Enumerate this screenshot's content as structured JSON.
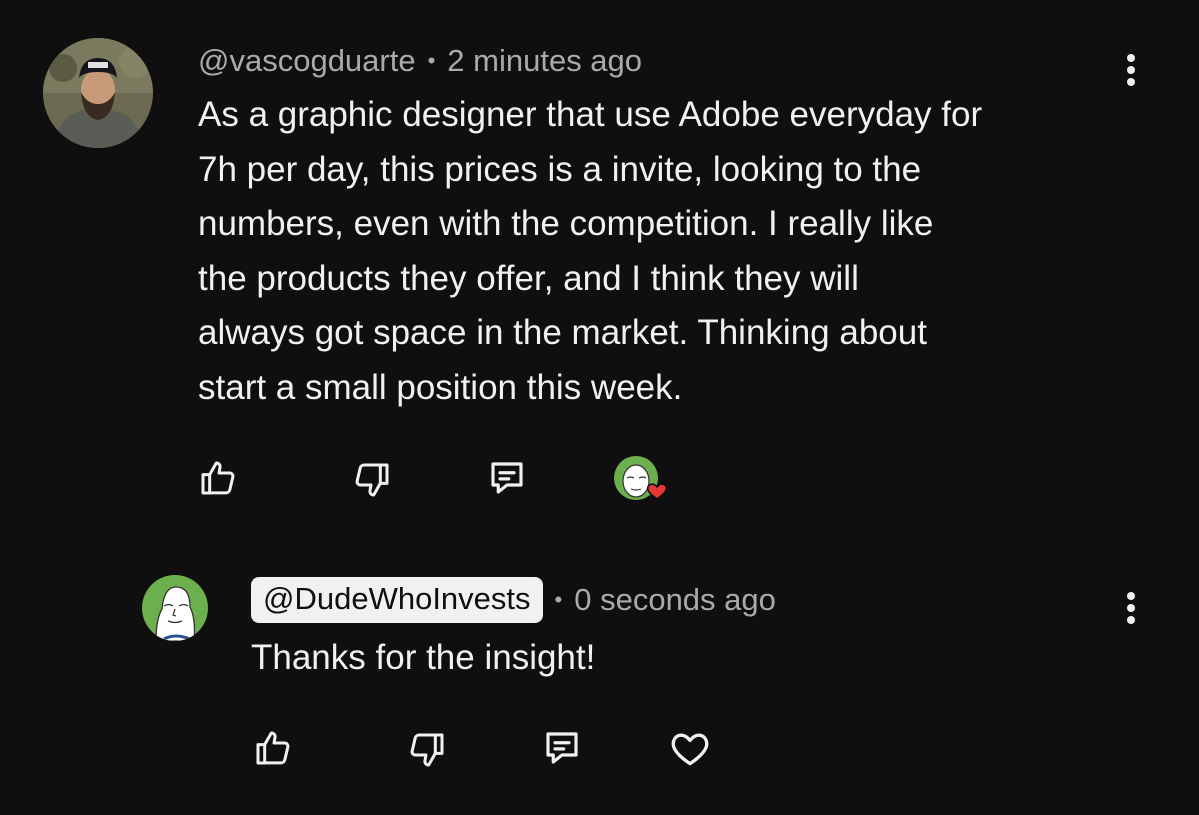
{
  "comment": {
    "author": "@vascogduarte",
    "separator": "•",
    "time": "2 minutes ago",
    "text_lines": [
      "As a graphic designer that use Adobe everyday for",
      "7h per day, this prices is a invite, looking to the",
      "numbers, even with the competition. I really like",
      "the products they offer, and I think they will",
      "always got space in the market. Thinking about",
      "start a small position this week."
    ],
    "icons": {
      "avatar": "user-avatar-photo",
      "menu": "more-vertical-icon",
      "like": "thumbs-up-icon",
      "dislike": "thumbs-down-icon",
      "reply": "reply-comment-icon",
      "hearted": "creator-heart-badge"
    }
  },
  "reply": {
    "author": "@DudeWhoInvests",
    "separator": "•",
    "time": "0 seconds ago",
    "text": "Thanks for the insight!",
    "icons": {
      "avatar": "wojak-avatar",
      "menu": "more-vertical-icon",
      "like": "thumbs-up-icon",
      "dislike": "thumbs-down-icon",
      "reply": "reply-comment-icon",
      "heart": "heart-outline-icon"
    }
  },
  "colors": {
    "background": "#0f0f0f",
    "text": "#f1f1f1",
    "meta": "#aaaaaa",
    "heart": "#e53935"
  }
}
